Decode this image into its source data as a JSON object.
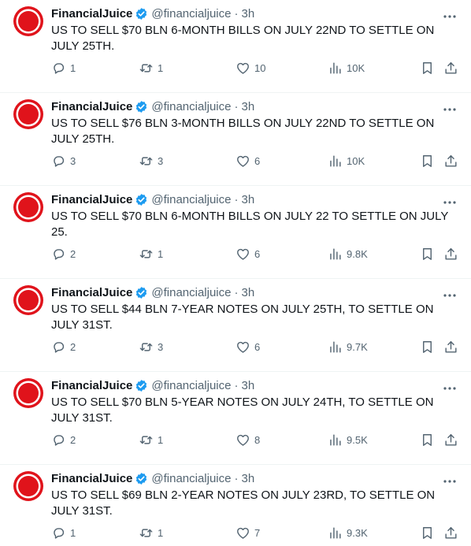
{
  "account": {
    "name": "FinancialJuice",
    "handle": "@financialjuice",
    "separator": "·"
  },
  "tweets": [
    {
      "time": "3h",
      "text": "US TO SELL $70 BLN 6-MONTH BILLS ON JULY 22ND TO SETTLE ON JULY 25TH.",
      "replies": "1",
      "retweets": "1",
      "likes": "10",
      "views": "10K"
    },
    {
      "time": "3h",
      "text": "US TO SELL $76 BLN 3-MONTH BILLS ON JULY 22ND TO SETTLE ON JULY 25TH.",
      "replies": "3",
      "retweets": "3",
      "likes": "6",
      "views": "10K"
    },
    {
      "time": "3h",
      "text": "US TO SELL $70 BLN 6-MONTH BILLS ON JULY 22 TO SETTLE ON JULY 25.",
      "replies": "2",
      "retweets": "1",
      "likes": "6",
      "views": "9.8K"
    },
    {
      "time": "3h",
      "text": "US TO SELL $44 BLN 7-YEAR NOTES ON JULY 25TH, TO SETTLE ON JULY 31ST.",
      "replies": "2",
      "retweets": "3",
      "likes": "6",
      "views": "9.7K"
    },
    {
      "time": "3h",
      "text": "US TO SELL $70 BLN 5-YEAR NOTES ON JULY 24TH, TO SETTLE ON JULY 31ST.",
      "replies": "2",
      "retweets": "1",
      "likes": "8",
      "views": "9.5K"
    },
    {
      "time": "3h",
      "text": "US TO SELL $69 BLN 2-YEAR NOTES ON JULY 23RD, TO SETTLE ON JULY 31ST.",
      "replies": "1",
      "retweets": "1",
      "likes": "7",
      "views": "9.3K"
    }
  ],
  "icons": {
    "avatar": "financialjuice-logo",
    "verified": "verified-badge-icon",
    "more": "more-icon",
    "reply": "reply-icon",
    "retweet": "retweet-icon",
    "like": "like-icon",
    "views": "views-icon",
    "bookmark": "bookmark-icon",
    "share": "share-icon"
  },
  "colors": {
    "brand_red": "#e0131b",
    "verified_blue": "#1d9bf0",
    "muted": "#536471",
    "text": "#0f1419"
  }
}
